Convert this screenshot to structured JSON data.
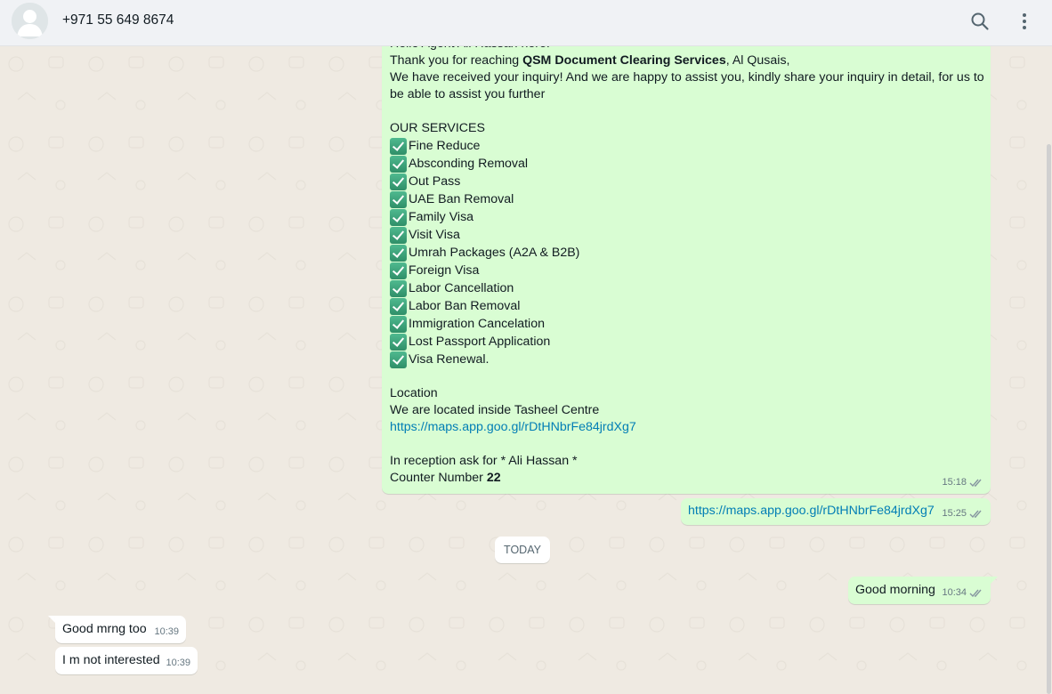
{
  "header": {
    "contact": "+971 55 649 8674",
    "icons": [
      "search-icon",
      "menu-icon"
    ]
  },
  "big_message": {
    "greeting": "Hello Agent Ali Hassan here.",
    "thanks_prefix": "Thank you for reaching ",
    "company": "QSM Document Clearing Services",
    "thanks_suffix": ", Al Qusais,",
    "line3": "We have received your inquiry! And we are happy to assist you, kindly share your inquiry in detail, for us to",
    "line4": "be able to assist you further",
    "services_heading": "OUR SERVICES",
    "services": [
      "Fine Reduce",
      "Absconding Removal",
      "Out Pass",
      "UAE Ban Removal",
      "Family Visa",
      "Visit Visa",
      "Umrah Packages (A2A & B2B)",
      "Foreign Visa",
      "Labor Cancellation",
      "Labor Ban Removal",
      "Immigration Cancelation",
      "Lost Passport Application",
      "Visa Renewal."
    ],
    "location_heading": "Location",
    "location_text": "We are located inside Tasheel Centre",
    "map_link": "https://maps.app.goo.gl/rDtHNbrFe84jrdXg7",
    "reception": "In reception ask for * Ali Hassan *",
    "counter_prefix": "Counter Number ",
    "counter_number": "22",
    "time": "15:18"
  },
  "link_message": {
    "text": "https://maps.app.goo.gl/rDtHNbrFe84jrdXg7",
    "time": "15:25"
  },
  "day_separator": "TODAY",
  "good_morning": {
    "text": "Good morning",
    "time": "10:34"
  },
  "incoming": [
    {
      "text": "Good mrng too",
      "time": "10:39"
    },
    {
      "text": "I m not interested",
      "time": "10:39"
    }
  ],
  "colors": {
    "outgoing_bubble": "#d9fdd3",
    "incoming_bubble": "#ffffff",
    "chat_background": "#efeae2",
    "link": "#027eb5",
    "header": "#f0f2f5"
  }
}
